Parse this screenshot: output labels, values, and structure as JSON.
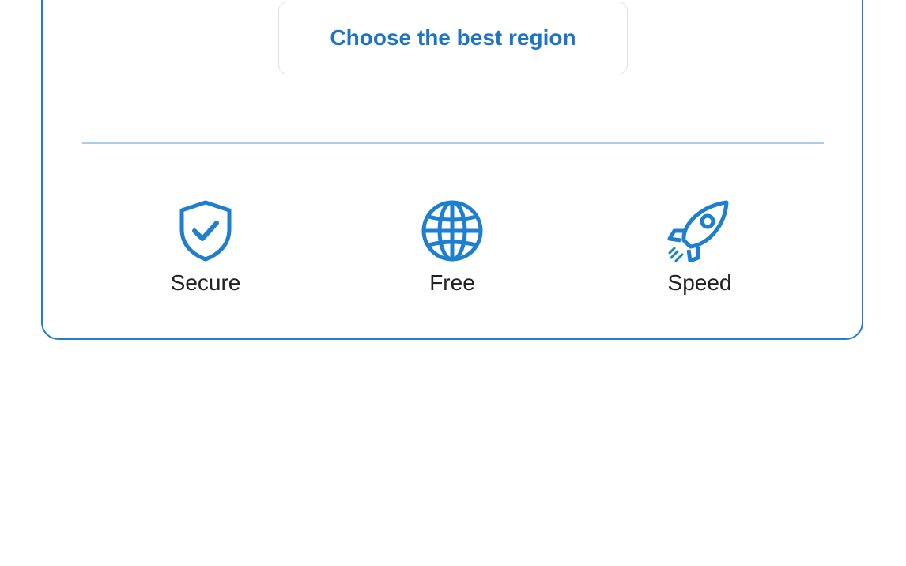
{
  "region_button": {
    "label": "Choose the best region"
  },
  "features": [
    {
      "label": "Secure",
      "icon": "shield-check-icon"
    },
    {
      "label": "Free",
      "icon": "globe-icon"
    },
    {
      "label": "Speed",
      "icon": "rocket-icon"
    }
  ],
  "colors": {
    "accent": "#1f7fcf",
    "button_text": "#1d74c6",
    "divider": "#a9cdeb",
    "label_text": "#222222"
  }
}
